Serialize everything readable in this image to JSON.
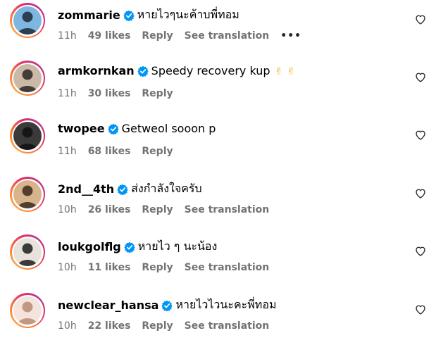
{
  "comments": [
    {
      "username": "zommarie",
      "text": "หายไวๆนะค้าบพี่ทอม",
      "emoji": "",
      "time": "11h",
      "likes": "49 likes",
      "reply": "Reply",
      "translation": "See translation",
      "more": "•••",
      "avatar_colors": [
        "#7fb6e0",
        "#1d2a3a"
      ]
    },
    {
      "username": "armkornkan",
      "text": "Speedy recovery kup",
      "emoji": "✌ ✌",
      "time": "11h",
      "likes": "30 likes",
      "reply": "Reply",
      "translation": "",
      "more": "",
      "avatar_colors": [
        "#c9b9a6",
        "#2b2624"
      ]
    },
    {
      "username": "twopee",
      "text": "Getweol sooon p",
      "emoji": "",
      "time": "11h",
      "likes": "68 likes",
      "reply": "Reply",
      "translation": "",
      "more": "",
      "avatar_colors": [
        "#3a3a3a",
        "#111111"
      ]
    },
    {
      "username": "2nd__4th",
      "text": "ส่งกำลังใจครับ",
      "emoji": "",
      "time": "10h",
      "likes": "26 likes",
      "reply": "Reply",
      "translation": "See translation",
      "more": "",
      "avatar_colors": [
        "#d8b48c",
        "#3b2a1e"
      ]
    },
    {
      "username": "loukgolflg",
      "text": "หายไว ๆ นะน้อง",
      "emoji": "",
      "time": "10h",
      "likes": "11 likes",
      "reply": "Reply",
      "translation": "See translation",
      "more": "",
      "avatar_colors": [
        "#e7e2dc",
        "#1c1c1c"
      ]
    },
    {
      "username": "newclear_hansa",
      "text": "หายไวไวนะคะพี่ทอม",
      "emoji": "",
      "time": "10h",
      "likes": "22 likes",
      "reply": "Reply",
      "translation": "See translation",
      "more": "",
      "avatar_colors": [
        "#f3e4de",
        "#b98a73"
      ]
    }
  ],
  "icons": {
    "verified": "verified-badge-icon",
    "heart": "heart-outline-icon"
  },
  "colors": {
    "verified": "#0095f6",
    "meta_text": "#737373"
  }
}
